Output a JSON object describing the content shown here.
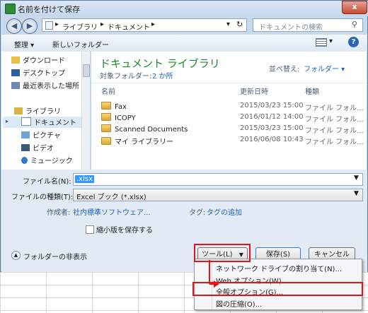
{
  "window": {
    "title": "名前を付けて保存",
    "close": "x"
  },
  "nav": {
    "back": "◀",
    "forward": "▶",
    "address_parts": [
      "ライブラリ",
      "ドキュメント"
    ],
    "refresh": "↻",
    "search_placeholder": "ドキュメントの検索"
  },
  "toolbar": {
    "organize": "整理 ▾",
    "new_folder": "新しいフォルダー",
    "help": "?"
  },
  "navpane": {
    "items": [
      "ダウンロード",
      "デスクトップ",
      "最近表示した場所",
      "ライブラリ",
      "ドキュメント",
      "ピクチャ",
      "ビデオ",
      "ミュージック"
    ]
  },
  "library": {
    "title": "ドキュメント ライブラリ",
    "target_label": "対象フォルダー:",
    "target_count": "2 か所",
    "sort_label": "並べ替え:",
    "sort_value": "フォルダー ▾"
  },
  "columns": {
    "name": "名前",
    "date": "更新日時",
    "type": "種類"
  },
  "files": [
    {
      "name": "Fax",
      "date": "2015/03/23 15:00",
      "type": "ファイル フォル..."
    },
    {
      "name": "ICOPY",
      "date": "2016/01/12 14:00",
      "type": "ファイル フォル..."
    },
    {
      "name": "Scanned Documents",
      "date": "2015/03/23 15:00",
      "type": "ファイル フォル..."
    },
    {
      "name": "マイ ライブラリー",
      "date": "2016/06/08 10:43",
      "type": "ファイル フォル..."
    }
  ],
  "form": {
    "filename_label": "ファイル名(N):",
    "filename_value": ".xlsx",
    "filetype_label": "ファイルの種類(T):",
    "filetype_value": "Excel ブック (*.xlsx)",
    "author_label": "作成者:",
    "author_value": "社内標準ソフトウェア...",
    "tag_label": "タグ:",
    "tag_value": "タグの追加",
    "thumbnail_label": "縮小版を保存する"
  },
  "footer": {
    "hide_folders": "フォルダーの非表示",
    "tools": "ツール(L)",
    "save": "保存(S)",
    "cancel": "キャンセル"
  },
  "tools_menu": {
    "items": [
      "ネットワーク ドライブの割り当て(N)...",
      "Web オプション(W)...",
      "全般オプション(G)...",
      "図の圧縮(O)..."
    ]
  },
  "colors": {
    "highlight_red": "#e0141c",
    "selection_blue": "#3399ff",
    "title_green": "#1a8a2e"
  }
}
